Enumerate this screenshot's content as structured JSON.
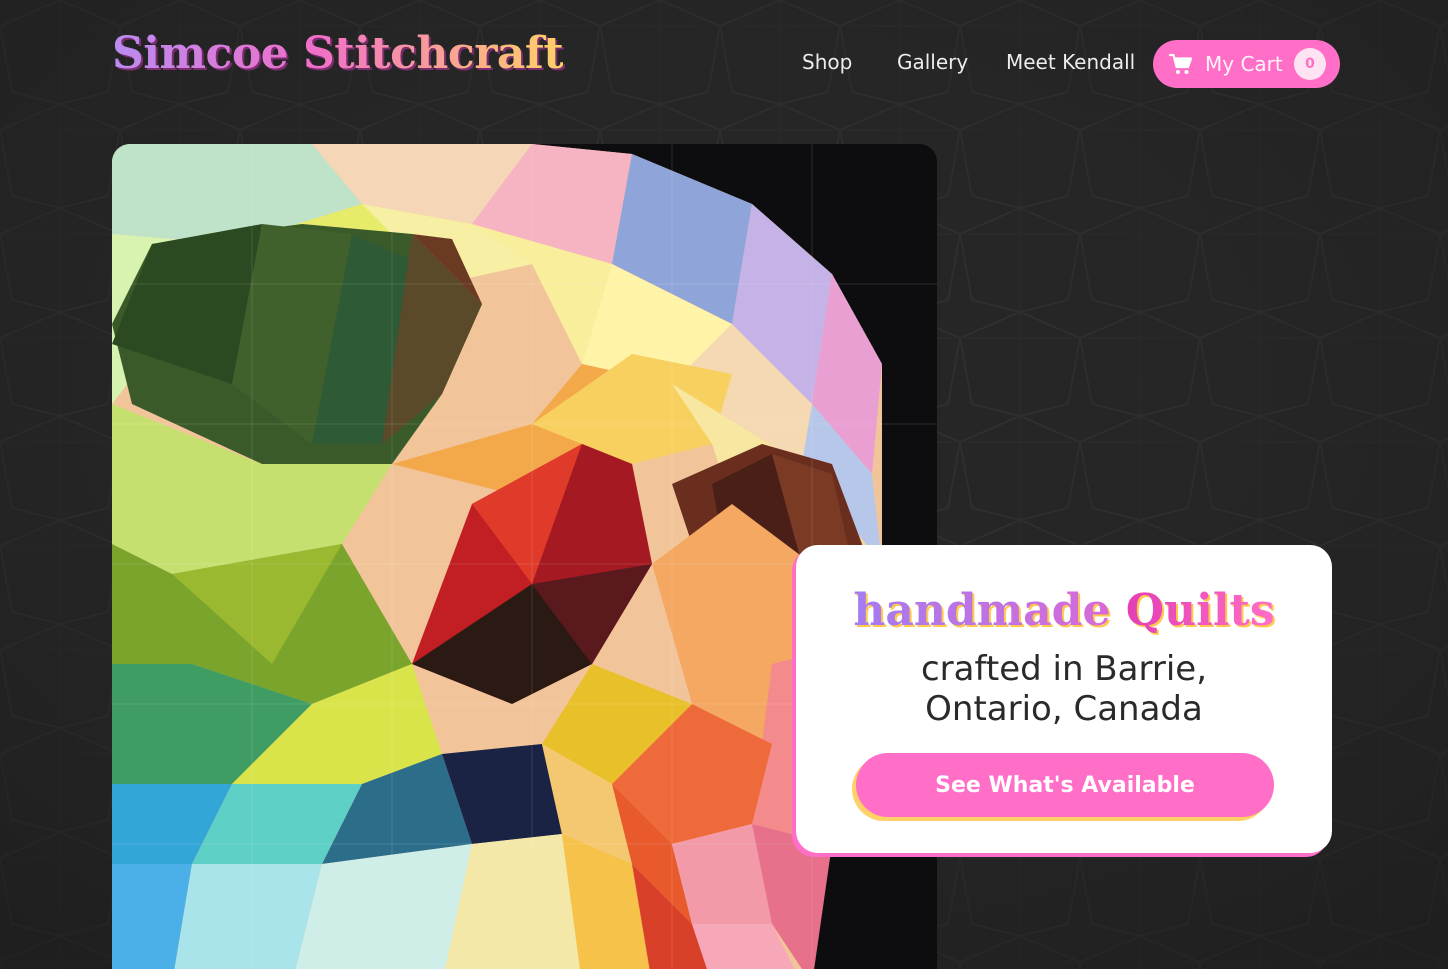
{
  "brand": {
    "name": "Simcoe Stitchcraft"
  },
  "nav": {
    "items": [
      {
        "label": "Shop"
      },
      {
        "label": "Gallery"
      },
      {
        "label": "Meet Kendall"
      }
    ]
  },
  "cart": {
    "label": "My Cart",
    "count": "0",
    "icon": "shopping-cart-icon"
  },
  "hero": {
    "image_alt": "geometric skull quilt"
  },
  "card": {
    "headline_word1": "handmade",
    "headline_word2": "Quilts",
    "subline": "crafted in Barrie, Ontario, Canada",
    "cta_label": "See What's Available"
  },
  "colors": {
    "background": "#262626",
    "accent_pink": "#ff6ec7",
    "accent_yellow": "#ffd166",
    "accent_purple": "#a47cf0"
  }
}
